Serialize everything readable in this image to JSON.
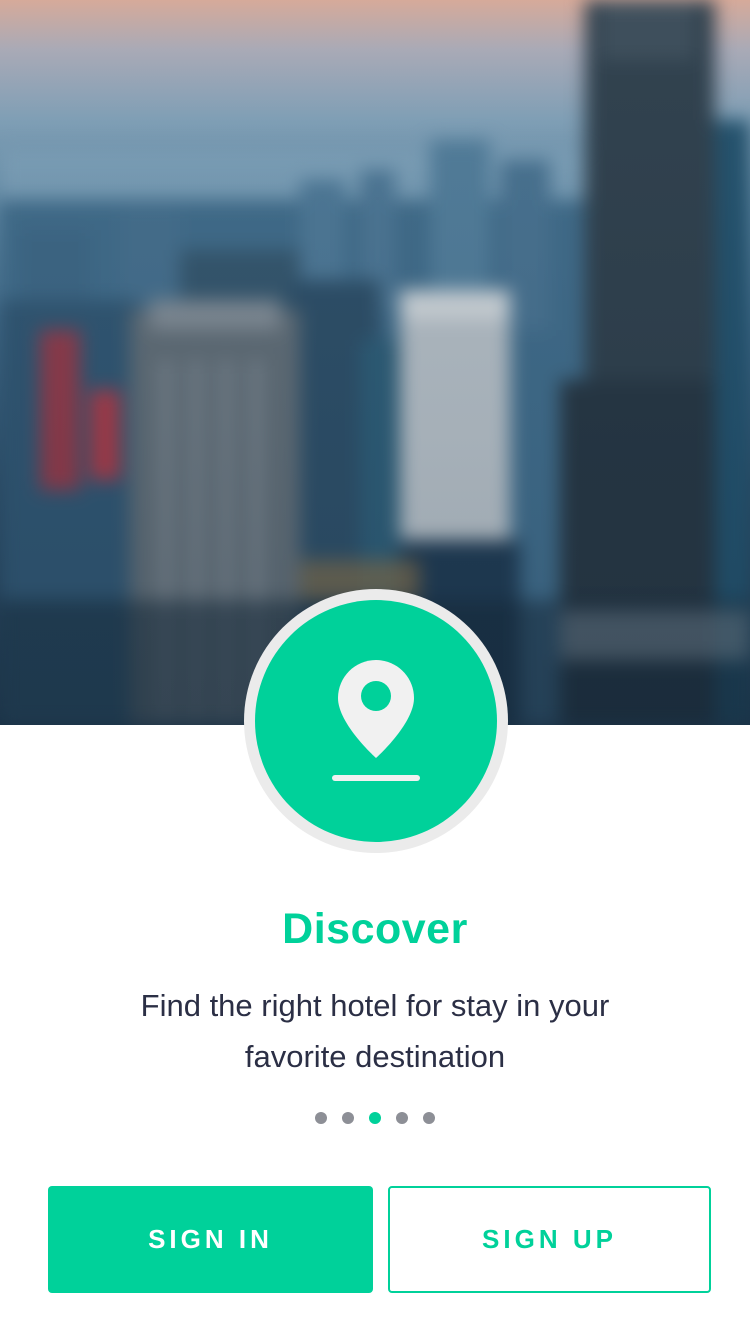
{
  "onboarding": {
    "title": "Discover",
    "subtitle": "Find the right hotel for stay in your favorite destination",
    "badge_icon": "map-pin-icon",
    "pages": {
      "count": 5,
      "active": 3
    },
    "sign_in_label": "SIGN IN",
    "sign_up_label": "SIGN UP"
  },
  "colors": {
    "accent": "#00d19a",
    "text_dark": "#2b2f45",
    "dot_inactive": "#8d8f96",
    "badge_ring": "#ebebeb"
  }
}
